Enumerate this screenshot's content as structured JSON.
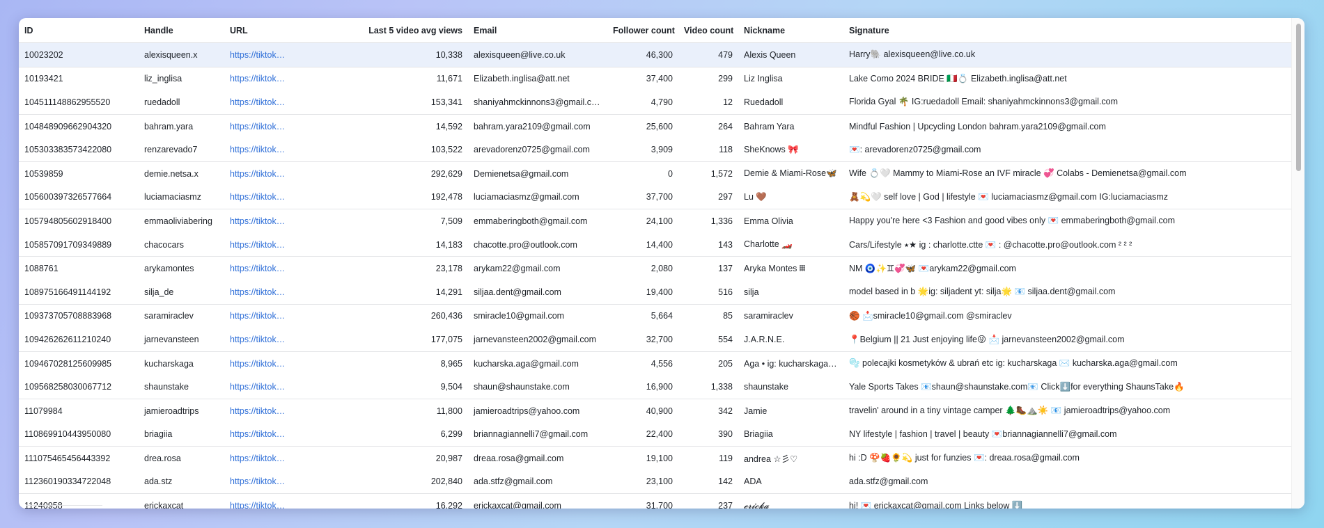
{
  "columns": [
    "ID",
    "Handle",
    "URL",
    "Last 5 video avg views",
    "Email",
    "Follower count",
    "Video count",
    "Nickname",
    "Signature"
  ],
  "rows": [
    {
      "id": "10023202",
      "handle": "alexisqueen.x",
      "url": "https://tiktok…",
      "avg_views": "10,338",
      "email": "alexisqueen@live.co.uk",
      "followers": "46,300",
      "videos": "479",
      "nickname": "Alexis Queen",
      "signature": "Harry🐘 alexisqueen@live.co.uk"
    },
    {
      "id": "10193421",
      "handle": "liz_inglisa",
      "url": "https://tiktok…",
      "avg_views": "11,671",
      "email": "Elizabeth.inglisa@att.net",
      "followers": "37,400",
      "videos": "299",
      "nickname": "Liz Inglisa",
      "signature": "Lake Como 2024 BRIDE 🇮🇹💍 Elizabeth.inglisa@att.net"
    },
    {
      "id": "104511148862955520",
      "handle": "ruedadoll",
      "url": "https://tiktok…",
      "avg_views": "153,341",
      "email": "shaniyahmckinnons3@gmail.com",
      "followers": "4,790",
      "videos": "12",
      "nickname": "Ruedadoll",
      "signature": "Florida Gyal 🌴 IG:ruedadoll Email: shaniyahmckinnons3@gmail.com"
    },
    {
      "id": "104848909662904320",
      "handle": "bahram.yara",
      "url": "https://tiktok…",
      "avg_views": "14,592",
      "email": "bahram.yara2109@gmail.com",
      "followers": "25,600",
      "videos": "264",
      "nickname": "Bahram Yara",
      "signature": "Mindful Fashion | Upcycling London bahram.yara2109@gmail.com"
    },
    {
      "id": "105303383573422080",
      "handle": "renzarevado7",
      "url": "https://tiktok…",
      "avg_views": "103,522",
      "email": "arevadorenz0725@gmail.com",
      "followers": "3,909",
      "videos": "118",
      "nickname": "SheKnows 🎀",
      "signature": "💌: arevadorenz0725@gmail.com"
    },
    {
      "id": "10539859",
      "handle": "demie.netsa.x",
      "url": "https://tiktok…",
      "avg_views": "292,629",
      "email": "Demienetsa@gmail.com",
      "followers": "0",
      "videos": "1,572",
      "nickname": "Demie & Miami-Rose🦋",
      "signature": "Wife 💍🤍 Mammy to Miami-Rose an IVF miracle 💞 Colabs - Demienetsa@gmail.com"
    },
    {
      "id": "105600397326577664",
      "handle": "luciamaciasmz",
      "url": "https://tiktok…",
      "avg_views": "192,478",
      "email": "luciamaciasmz@gmail.com",
      "followers": "37,700",
      "videos": "297",
      "nickname": "Lu 🤎",
      "signature": "🧸💫🤍 self love | God | lifestyle 💌 luciamaciasmz@gmail.com IG:luciamaciasmz"
    },
    {
      "id": "105794805602918400",
      "handle": "emmaoliviabering",
      "url": "https://tiktok…",
      "avg_views": "7,509",
      "email": "emmaberingboth@gmail.com",
      "followers": "24,100",
      "videos": "1,336",
      "nickname": "Emma Olivia",
      "signature": "Happy you're here <3 Fashion and good vibes only 💌 emmaberingboth@gmail.com"
    },
    {
      "id": "105857091709349889",
      "handle": "chacocars",
      "url": "https://tiktok…",
      "avg_views": "14,183",
      "email": "chacotte.pro@outlook.com",
      "followers": "14,400",
      "videos": "143",
      "nickname": "Charlotte 🏎️",
      "signature": "Cars/Lifestyle ⭑★ ig : charlotte.ctte 💌 : @chacotte.pro@outlook.com ² ² ²"
    },
    {
      "id": "1088761",
      "handle": "arykamontes",
      "url": "https://tiktok…",
      "avg_views": "23,178",
      "email": "arykam22@gmail.com",
      "followers": "2,080",
      "videos": "137",
      "nickname": "Aryka Montes 𝄜",
      "signature": "NM 🧿✨♊💞🦋 💌arykam22@gmail.com"
    },
    {
      "id": "108975166491144192",
      "handle": "silja_de",
      "url": "https://tiktok…",
      "avg_views": "14,291",
      "email": "siljaa.dent@gmail.com",
      "followers": "19,400",
      "videos": "516",
      "nickname": "silja",
      "signature": "model based in b 🌟ig: siljadent yt: silja🌟 📧 siljaa.dent@gmail.com"
    },
    {
      "id": "109373705708883968",
      "handle": "saramiraclev",
      "url": "https://tiktok…",
      "avg_views": "260,436",
      "email": "smiracle10@gmail.com",
      "followers": "5,664",
      "videos": "85",
      "nickname": "saramiraclev",
      "signature": "🏀 📩smiracle10@gmail.com @smiraclev"
    },
    {
      "id": "109426262611210240",
      "handle": "jarnevansteen",
      "url": "https://tiktok…",
      "avg_views": "177,075",
      "email": "jarnevansteen2002@gmail.com",
      "followers": "32,700",
      "videos": "554",
      "nickname": "J.A.R.N.E.",
      "signature": "📍Belgium || 21 Just enjoying life😜 📩 jarnevansteen2002@gmail.com"
    },
    {
      "id": "109467028125609985",
      "handle": "kucharskaga",
      "url": "https://tiktok…",
      "avg_views": "8,965",
      "email": "kucharska.aga@gmail.com",
      "followers": "4,556",
      "videos": "205",
      "nickname": "Aga • ig: kucharskaga…",
      "signature": "🫧 polecajki kosmetyków & ubrań etc ig: kucharskaga ✉️ kucharska.aga@gmail.com"
    },
    {
      "id": "109568258030067712",
      "handle": "shaunstake",
      "url": "https://tiktok…",
      "avg_views": "9,504",
      "email": "shaun@shaunstake.com",
      "followers": "16,900",
      "videos": "1,338",
      "nickname": "shaunstake",
      "signature": "Yale Sports Takes 📧shaun@shaunstake.com📧 Click⬇️for everything ShaunsTake🔥"
    },
    {
      "id": "11079984",
      "handle": "jamieroadtrips",
      "url": "https://tiktok…",
      "avg_views": "11,800",
      "email": "jamieroadtrips@yahoo.com",
      "followers": "40,900",
      "videos": "342",
      "nickname": "Jamie",
      "signature": "travelin' around in a tiny vintage camper 🌲🥾⛰️☀️ 📧 jamieroadtrips@yahoo.com"
    },
    {
      "id": "110869910443950080",
      "handle": "briagiia",
      "url": "https://tiktok…",
      "avg_views": "6,299",
      "email": "briannagiannelli7@gmail.com",
      "followers": "22,400",
      "videos": "390",
      "nickname": "Briagiia",
      "signature": "NY lifestyle | fashion | travel | beauty 💌briannagiannelli7@gmail.com"
    },
    {
      "id": "111075465456443392",
      "handle": "drea.rosa",
      "url": "https://tiktok…",
      "avg_views": "20,987",
      "email": "dreaa.rosa@gmail.com",
      "followers": "19,100",
      "videos": "119",
      "nickname": "andrea ☆彡♡",
      "signature": "hi :D 🍄🍓🌻💫 just for funzies 💌: dreaa.rosa@gmail.com"
    },
    {
      "id": "112360190334722048",
      "handle": "ada.stz",
      "url": "https://tiktok…",
      "avg_views": "202,840",
      "email": "ada.stfz@gmail.com",
      "followers": "23,100",
      "videos": "142",
      "nickname": "ADA",
      "signature": "ada.stfz@gmail.com"
    },
    {
      "id": "11240958",
      "handle": "erickaxcat",
      "url": "https://tiktok…",
      "avg_views": "16,292",
      "email": "erickaxcat@gmail.com",
      "followers": "31,700",
      "videos": "237",
      "nickname": "𝓮𝓻𝓲𝓬𝓴𝓪",
      "signature": "hi! 💌 erickaxcat@gmail.com Links below ⬇️"
    }
  ]
}
